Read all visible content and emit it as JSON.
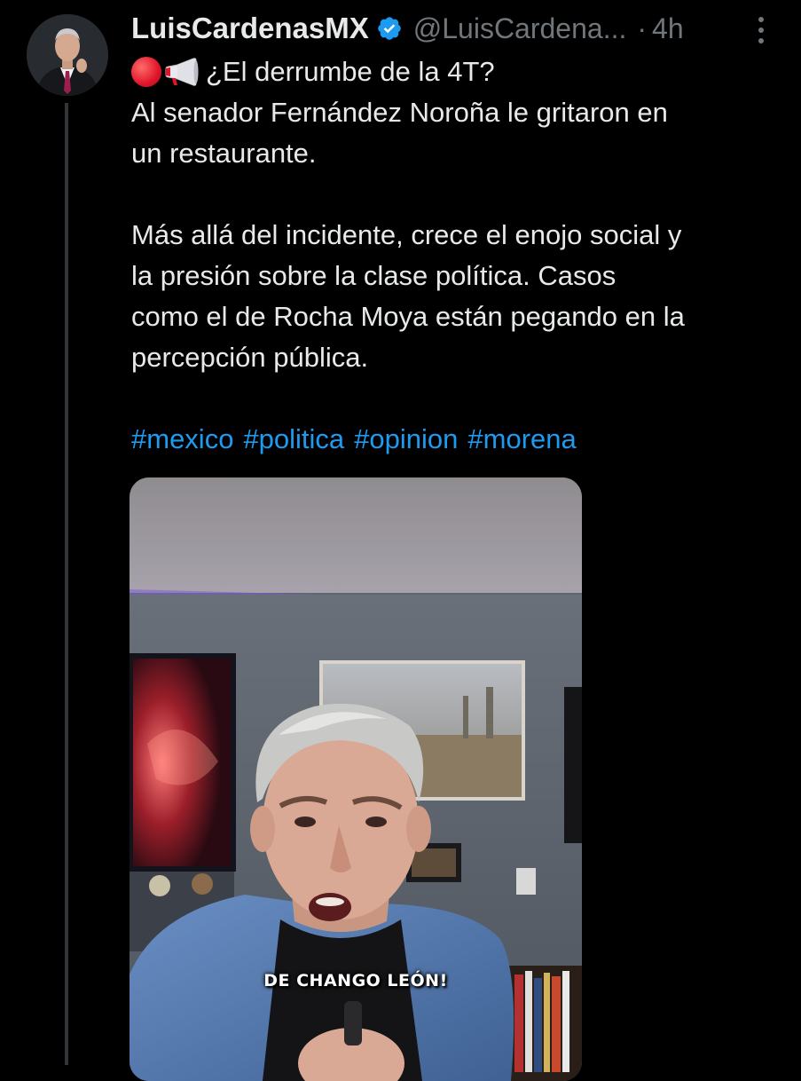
{
  "tweet": {
    "display_name": "LuisCardenasMX",
    "verified_icon": "verified-badge-icon",
    "handle": "@LuisCardena...",
    "separator": "·",
    "time": "4h",
    "more_icon": "more-options-icon",
    "avatar_icon": "profile-avatar",
    "emojis": [
      "red-circle-icon",
      "megaphone-icon"
    ],
    "lines": [
      "¿El derrumbe de la 4T?",
      "Al senador Fernández Noroña le gritaron en",
      "un restaurante.",
      "Más allá del incidente, crece el enojo social y",
      "la presión sobre la clase política. Casos",
      "como el de Rocha Moya están pegando en la",
      "percepción pública."
    ],
    "hashtags": [
      "#mexico",
      "#politica",
      "#opinion",
      "#morena"
    ]
  },
  "media": {
    "type": "video-thumbnail",
    "caption": "DE CHANGO LEÓN!"
  },
  "colors": {
    "background": "#000000",
    "text": "#e7e9ea",
    "secondary": "#71767b",
    "link": "#1d9bf0",
    "verified": "#1d9bf0",
    "thread_line": "#333639"
  }
}
